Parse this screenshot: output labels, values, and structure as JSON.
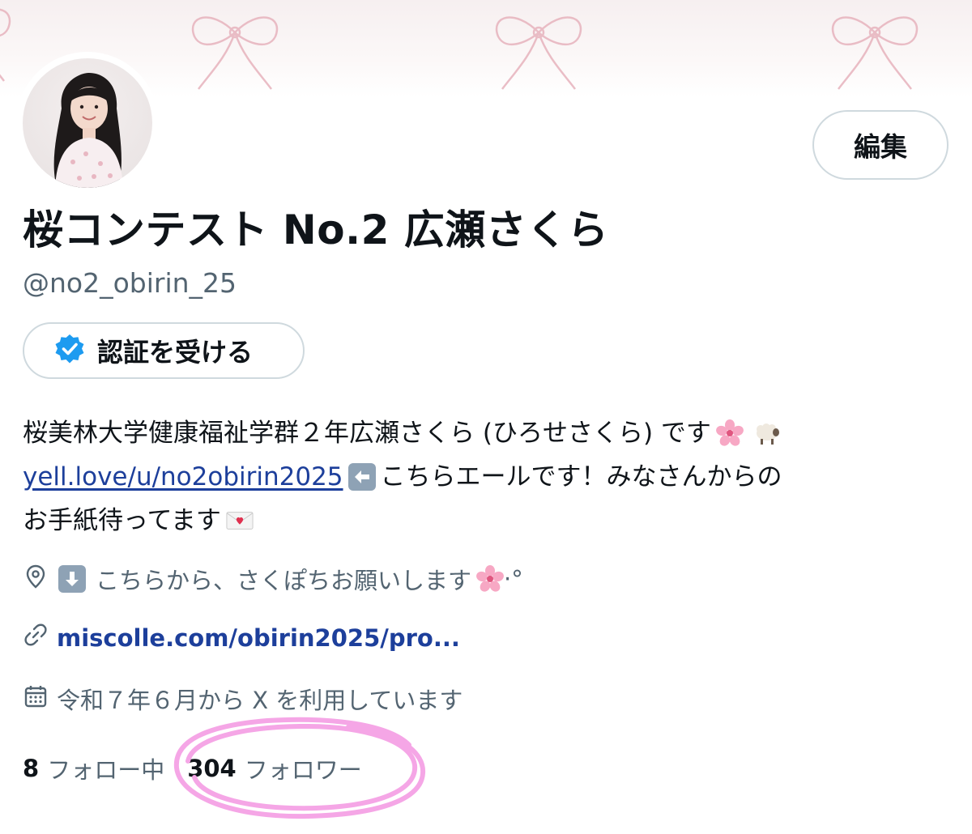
{
  "profile": {
    "display_name": "桜コンテスト No.2 広瀬さくら",
    "handle": "@no2_obirin_25",
    "edit_label": "編集",
    "verify_label": "認証を受ける"
  },
  "bio": {
    "line1_text": "桜美林大学健康福祉学群２年広瀬さくら (ひろせさくら) です",
    "line1_emojis": [
      "cherry-blossom",
      "sheep"
    ],
    "line2_link": "yell.love/u/no2obirin2025",
    "line2_text": "こちらエールです！みなさんからの",
    "line2_emoji": "left-arrow",
    "line3_text": "お手紙待ってます",
    "line3_emoji": "love-letter"
  },
  "meta": {
    "location_text": "こちらから、さくぽちお願いします",
    "location_suffix": "·°",
    "location_icon": "pin-icon",
    "website": "miscolle.com/obirin2025/pro...",
    "joined": "令和７年６月から X を利用しています"
  },
  "stats": {
    "following_count": "8",
    "following_label": "フォロー中",
    "followers_count": "304",
    "followers_label": "フォロワー"
  },
  "colors": {
    "text": "#0f1419",
    "muted": "#536471",
    "link": "#1d3f9b",
    "verify_badge": "#1d9bf0",
    "highlight_circle": "#f5a6e6",
    "banner_ribbon": "#e7b3bd"
  }
}
